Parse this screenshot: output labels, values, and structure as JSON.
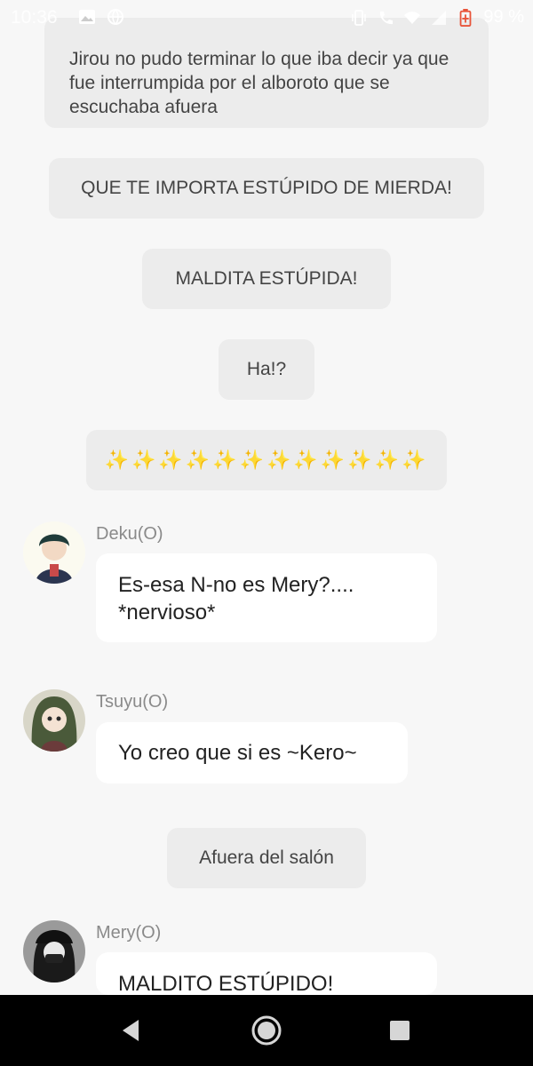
{
  "status_bar": {
    "time": "10:36",
    "battery_percent": "99 %",
    "icons_left": [
      "image-icon",
      "globe-icon"
    ],
    "icons_right": [
      "vibrate-icon",
      "call-icon",
      "wifi-icon",
      "signal-icon",
      "battery-charging-icon"
    ]
  },
  "messages": {
    "narration_1": "Jirou no pudo terminar lo que iba decir ya que fue interrumpida por el alboroto que se escuchaba afuera",
    "narration_2": "QUE TE IMPORTA ESTÚPIDO DE MIERDA!",
    "narration_3": "MALDITA ESTÚPIDA!",
    "narration_4": "Ha!?",
    "narration_5": "✨✨✨✨✨✨✨✨✨✨✨✨",
    "narration_6": "Afuera del salón"
  },
  "chat": [
    {
      "user": "Deku(O)",
      "text": "Es-esa N-no es Mery?.... *nervioso*"
    },
    {
      "user": "Tsuyu(O)",
      "text": "Yo creo que si es ~Kero~"
    },
    {
      "user": "Mery(O)",
      "text": "MALDITO ESTÚPIDO!"
    }
  ],
  "nav": {
    "buttons": [
      "back-icon",
      "home-icon",
      "recents-icon"
    ]
  },
  "colors": {
    "background": "#f7f7f7",
    "narration_bg": "#ececec",
    "bubble_bg": "#ffffff",
    "nav_bg": "#000000",
    "battery_accent": "#e8543a"
  }
}
